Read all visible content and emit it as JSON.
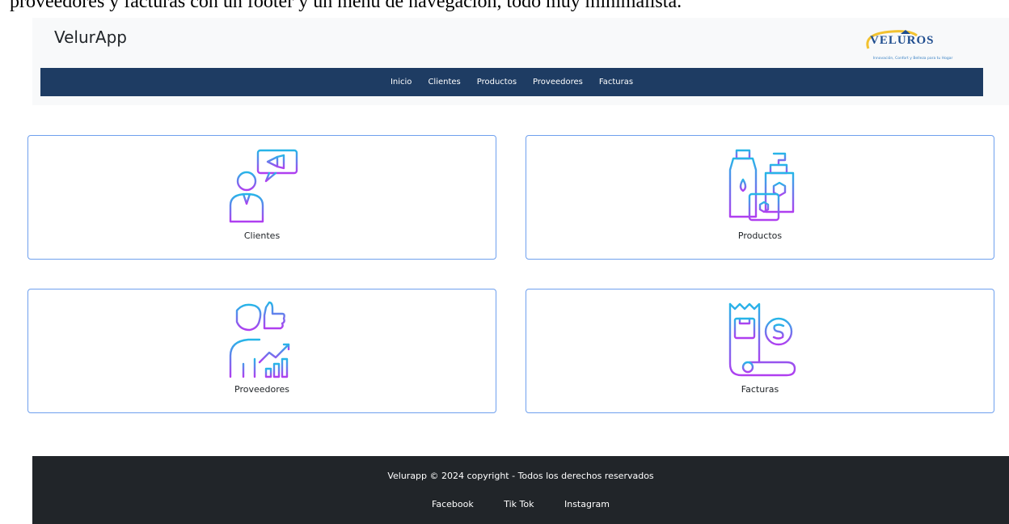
{
  "document": {
    "text": "proveedores y facturas con un footer y un menú de navegación, todo muy minimalista."
  },
  "header": {
    "brand": "VelurApp",
    "logo": {
      "name": "VELUROS",
      "tagline": "Innovación, Confort y Belleza para tu Hogar"
    },
    "nav": [
      "Inicio",
      "Clientes",
      "Productos",
      "Proveedores",
      "Facturas"
    ]
  },
  "cards": [
    {
      "label": "Clientes",
      "icon": "client-megaphone-icon"
    },
    {
      "label": "Productos",
      "icon": "cosmetic-products-icon"
    },
    {
      "label": "Proveedores",
      "icon": "supplier-growth-icon"
    },
    {
      "label": "Facturas",
      "icon": "invoice-dollar-icon"
    }
  ],
  "footer": {
    "copyright": "Velurapp © 2024 copyright - Todos los derechos reservados",
    "social": [
      "Facebook",
      "Tik Tok",
      "Instagram"
    ]
  },
  "colors": {
    "navbar": "#1e3c63",
    "footer": "#212529",
    "card_border": "#6fa0ee",
    "icon_gradient_start": "#26b6e8",
    "icon_gradient_end": "#b03ef0"
  }
}
